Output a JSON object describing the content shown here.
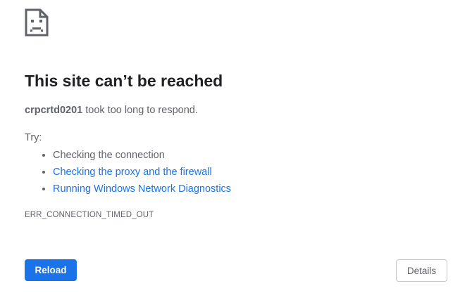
{
  "error_page": {
    "icon": "sad-page-icon",
    "heading": "This site can’t be reached",
    "message": {
      "host": "crpcrtd0201",
      "text": " took too long to respond."
    },
    "try_label": "Try:",
    "suggestions": [
      {
        "label": "Checking the connection",
        "is_link": false
      },
      {
        "label": "Checking the proxy and the firewall",
        "is_link": true
      },
      {
        "label": "Running Windows Network Diagnostics",
        "is_link": true
      }
    ],
    "error_code": "ERR_CONNECTION_TIMED_OUT",
    "reload_label": "Reload",
    "details_label": "Details"
  },
  "colors": {
    "text": "#5f6368",
    "heading": "#202124",
    "link": "#1a73e8",
    "primary_button": "#1a73e8"
  }
}
